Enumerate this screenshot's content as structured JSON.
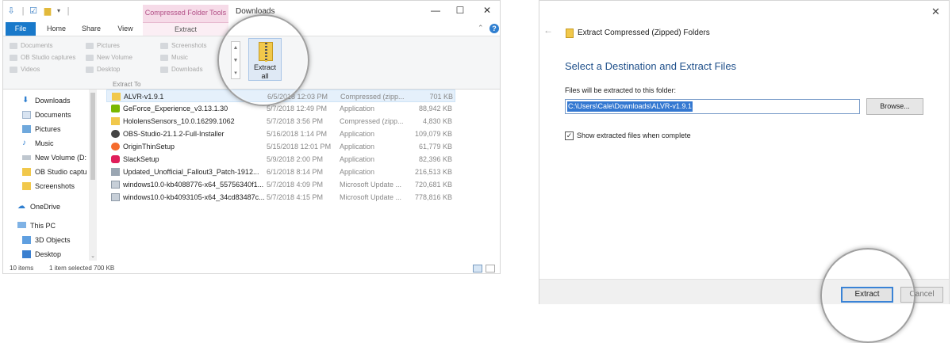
{
  "explorer": {
    "window_title": "Downloads",
    "context_tab": "Compressed Folder Tools",
    "tabs": [
      "File",
      "Home",
      "Share",
      "View"
    ],
    "extract_tab": "Extract",
    "ribbon": {
      "col1": [
        "Documents",
        "OB Studio captures",
        "Videos"
      ],
      "col2": [
        "Pictures",
        "New Volume",
        "Desktop"
      ],
      "col3": [
        "Screenshots",
        "Music",
        "Downloads"
      ],
      "group_label": "Extract To",
      "extract_all_label": "Extract\nall"
    },
    "nav": {
      "quick": [
        "Downloads",
        "Documents",
        "Pictures",
        "Music",
        "New Volume (D:",
        "OB Studio captu",
        "Screenshots"
      ],
      "onedrive": "OneDrive",
      "thispc": "This PC",
      "pc_items": [
        "3D Objects",
        "Desktop"
      ]
    },
    "files": [
      {
        "name": "ALVR-v1.9.1",
        "date": "6/5/2018 12:03 PM",
        "type": "Compressed (zipp...",
        "size": "701 KB",
        "icon": "zip-icon"
      },
      {
        "name": "GeForce_Experience_v3.13.1.30",
        "date": "5/7/2018 12:49 PM",
        "type": "Application",
        "size": "88,942 KB",
        "icon": "app-icon"
      },
      {
        "name": "HololensSensors_10.0.16299.1062",
        "date": "5/7/2018 3:56 PM",
        "type": "Compressed (zipp...",
        "size": "4,830 KB",
        "icon": "zip-icon"
      },
      {
        "name": "OBS-Studio-21.1.2-Full-Installer",
        "date": "5/16/2018 1:14 PM",
        "type": "Application",
        "size": "109,079 KB",
        "icon": "app-icon"
      },
      {
        "name": "OriginThinSetup",
        "date": "5/15/2018 12:01 PM",
        "type": "Application",
        "size": "61,779 KB",
        "icon": "origin-icon"
      },
      {
        "name": "SlackSetup",
        "date": "5/9/2018 2:00 PM",
        "type": "Application",
        "size": "82,396 KB",
        "icon": "slack-icon"
      },
      {
        "name": "Updated_Unofficial_Fallout3_Patch-1912...",
        "date": "6/1/2018 8:14 PM",
        "type": "Application",
        "size": "216,513 KB",
        "icon": "app-icon"
      },
      {
        "name": "windows10.0-kb4088776-x64_55756340f1...",
        "date": "5/7/2018 4:09 PM",
        "type": "Microsoft Update ...",
        "size": "720,681 KB",
        "icon": "update-icon"
      },
      {
        "name": "windows10.0-kb4093105-x64_34cd83487c...",
        "date": "5/7/2018 4:15 PM",
        "type": "Microsoft Update ...",
        "size": "778,816 KB",
        "icon": "update-icon"
      }
    ],
    "status": {
      "count": "10 items",
      "selected": "1 item selected  700 KB"
    }
  },
  "dialog": {
    "title": "Extract Compressed (Zipped) Folders",
    "heading": "Select a Destination and Extract Files",
    "label": "Files will be extracted to this folder:",
    "path": "C:\\Users\\Cale\\Downloads\\ALVR-v1.9.1",
    "browse": "Browse...",
    "checkbox_label": "Show extracted files when complete",
    "extract": "Extract",
    "cancel": "Cancel"
  }
}
